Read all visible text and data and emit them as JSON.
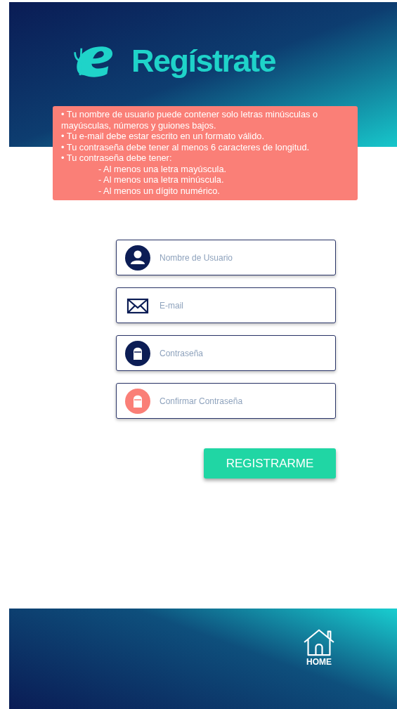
{
  "header": {
    "title": "Regístrate"
  },
  "rules": [
    "• Tu nombre de usuario puede contener solo letras minúsculas o mayúsculas, números y guiones bajos.",
    "• Tu e-mail debe estar escrito en un formato válido.",
    "• Tu contraseña debe tener al menos 6 caracteres de longitud.",
    "• Tu contraseña debe tener:"
  ],
  "subrules": [
    "- Al menos una letra mayúscula.",
    "- Al menos una letra minúscula.",
    "- Al menos un dígito numérico."
  ],
  "fields": [
    {
      "kind": "user",
      "placeholder": "Nombre de Usuario"
    },
    {
      "kind": "email",
      "placeholder": "E-mail"
    },
    {
      "kind": "password",
      "placeholder": "Contraseña"
    },
    {
      "kind": "confirm",
      "placeholder": "Confirmar Contraseña"
    }
  ],
  "submit": "REGISTRARME",
  "footer": {
    "home": "HOME"
  }
}
